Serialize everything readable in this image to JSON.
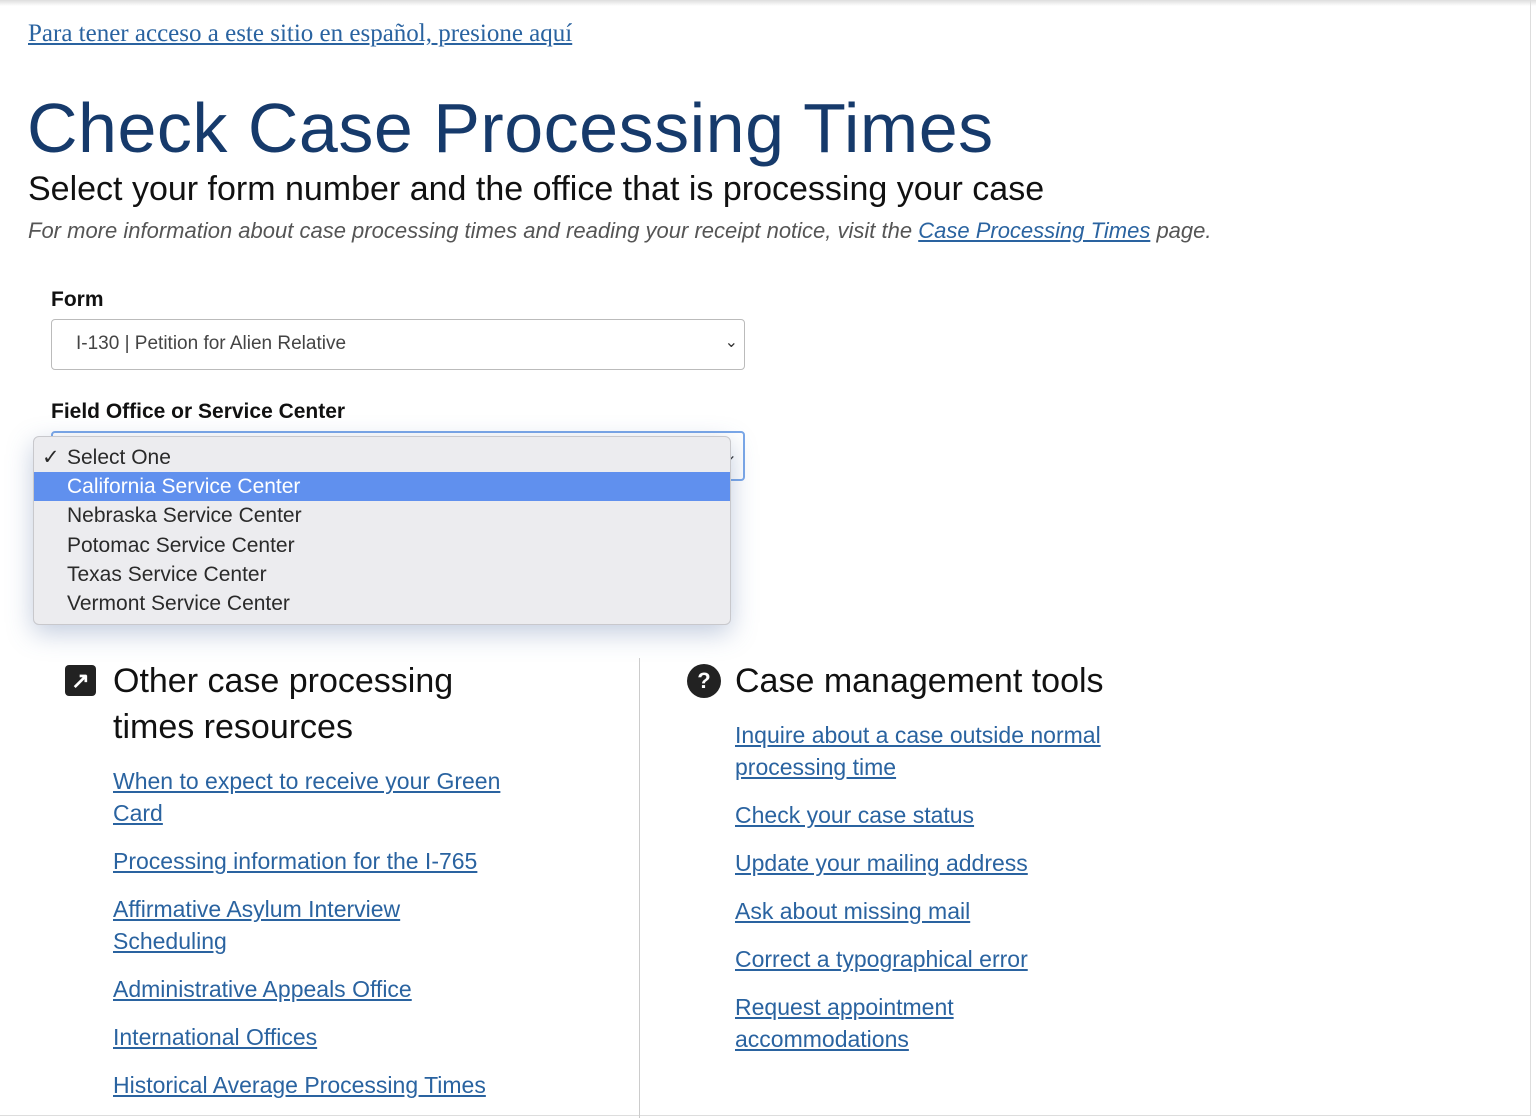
{
  "spanish_link": "Para tener acceso a este sitio en español, presione aquí",
  "title": "Check Case Processing Times",
  "subtitle": "Select your form number and the office that is processing your case",
  "info": {
    "before": "For more information about case processing times and reading your receipt notice, visit the ",
    "link": "Case Processing Times",
    "after": " page."
  },
  "form": {
    "label": "Form",
    "value": "I-130 | Petition for Alien Relative"
  },
  "office": {
    "label": "Field Office or Service Center",
    "options": [
      "Select One",
      "California Service Center",
      "Nebraska Service Center",
      "Potomac Service Center",
      "Texas Service Center",
      "Vermont Service Center"
    ],
    "selected": "Select One",
    "highlighted": "California Service Center"
  },
  "left": {
    "heading": "Other case processing times resources",
    "links": [
      "When to expect to receive your Green Card",
      "Processing information for the I-765",
      "Affirmative Asylum Interview Scheduling",
      "Administrative Appeals Office",
      "International Offices",
      "Historical Average Processing Times"
    ]
  },
  "right": {
    "heading": "Case management tools",
    "links": [
      "Inquire about a case outside normal processing time",
      "Check your case status",
      "Update your mailing address",
      "Ask about missing mail",
      "Correct a typographical error",
      "Request appointment accommodations"
    ]
  },
  "colors": {
    "title": "#163a6b",
    "link": "#2a63a0",
    "highlight": "#6090ee"
  }
}
